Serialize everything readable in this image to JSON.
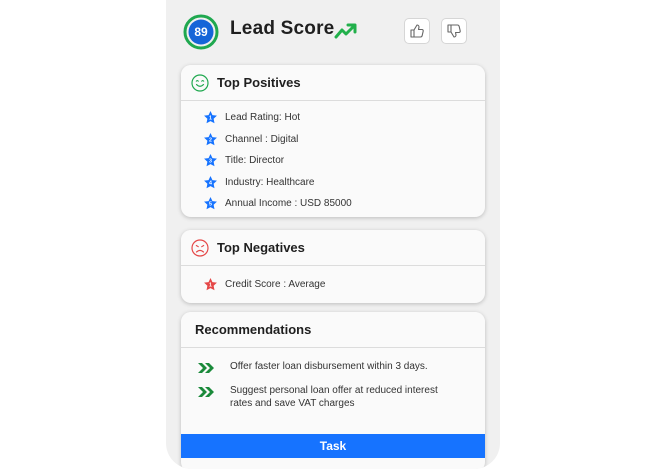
{
  "header": {
    "score": "89",
    "title": "Lead Score",
    "trend_icon": "trending-up-icon",
    "thumbs_up_icon": "thumbs-up-icon",
    "thumbs_down_icon": "thumbs-down-icon"
  },
  "positives": {
    "title": "Top Positives",
    "icon": "smile-icon",
    "items": [
      {
        "rank": "1",
        "label": "Lead Rating: Hot"
      },
      {
        "rank": "2",
        "label": "Channel : Digital"
      },
      {
        "rank": "3",
        "label": "Title: Director"
      },
      {
        "rank": "4",
        "label": "Industry: Healthcare"
      },
      {
        "rank": "5",
        "label": "Annual Income : USD 85000"
      }
    ]
  },
  "negatives": {
    "title": "Top Negatives",
    "icon": "frown-icon",
    "items": [
      {
        "rank": "1",
        "label": "Credit Score : Average"
      }
    ]
  },
  "recommendations": {
    "title": "Recommendations",
    "items": [
      {
        "label": "Offer faster loan disbursement within 3 days."
      },
      {
        "label": "Suggest personal loan offer at reduced interest rates and save VAT charges"
      }
    ]
  },
  "task_button": {
    "label": "Task"
  },
  "colors": {
    "score_ring": "#1fa84f",
    "score_fill": "#1565d8",
    "trend": "#22b04b",
    "positive_star": "#1673ff",
    "negative_star": "#e54848",
    "chevron": "#1a8a3a",
    "task_button": "#1673ff"
  }
}
